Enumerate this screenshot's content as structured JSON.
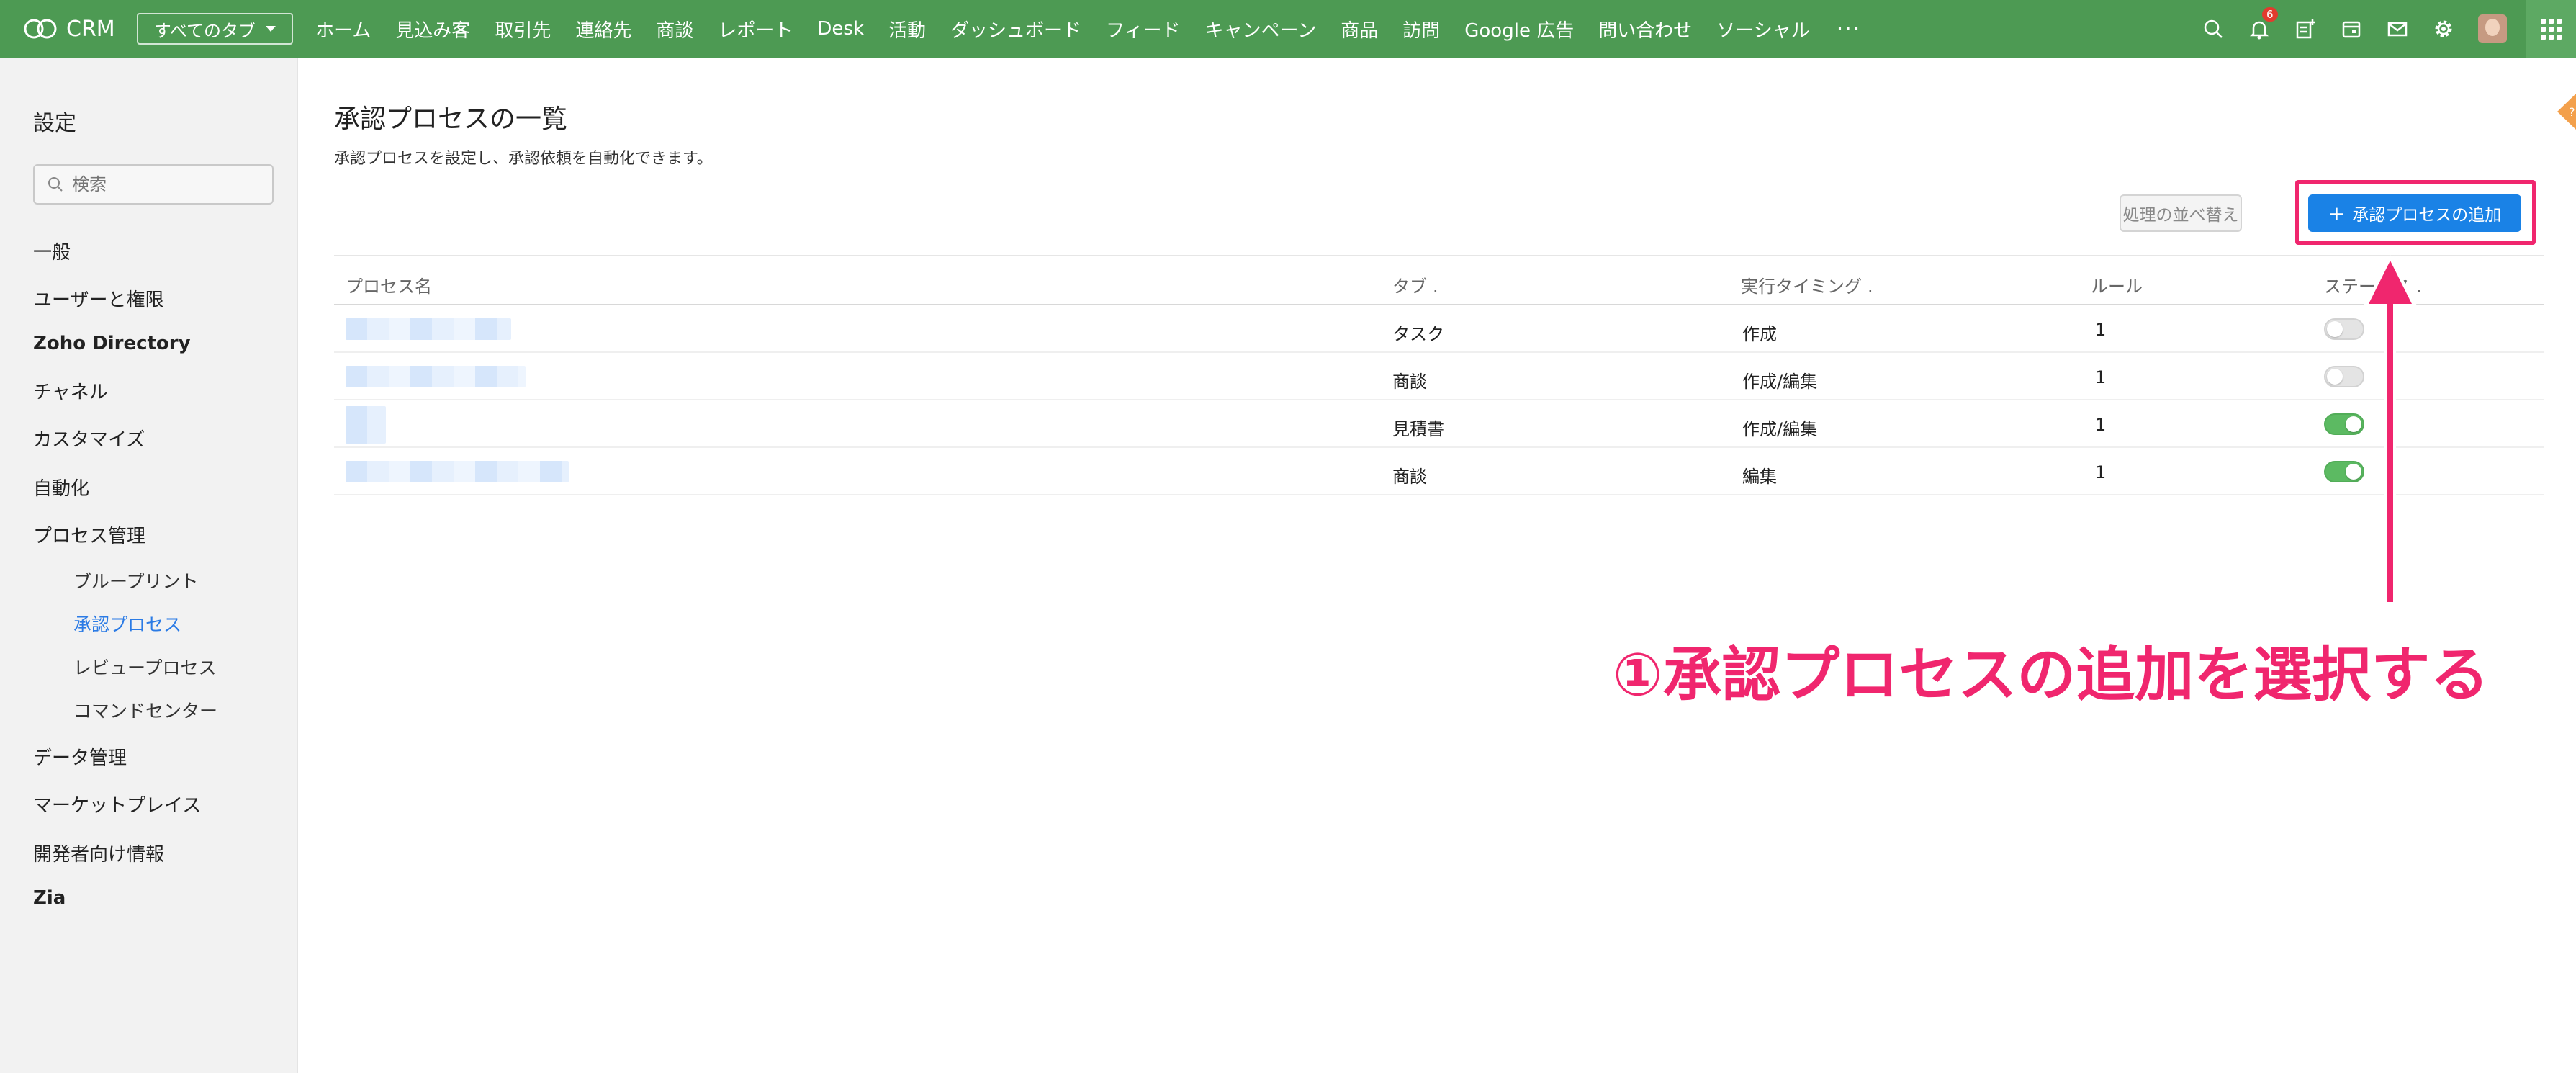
{
  "topbar": {
    "app_name": "CRM",
    "all_tabs_label": "すべてのタブ",
    "nav": [
      "ホーム",
      "見込み客",
      "取引先",
      "連絡先",
      "商談",
      "レポート",
      "Desk",
      "活動",
      "ダッシュボード",
      "フィード",
      "キャンペーン",
      "商品",
      "訪問",
      "Google 広告",
      "問い合わせ",
      "ソーシャル"
    ],
    "more": "···",
    "notification_count": "6",
    "colors": {
      "bar": "#4d9a53"
    }
  },
  "sidebar": {
    "title": "設定",
    "search_placeholder": "検索",
    "items": [
      "一般",
      "ユーザーと権限",
      "Zoho Directory",
      "チャネル",
      "カスタマイズ",
      "自動化",
      "プロセス管理",
      "データ管理",
      "マーケットプレイス",
      "開発者向け情報",
      "Zia"
    ],
    "subitems": [
      "ブループリント",
      "承認プロセス",
      "レビュープロセス",
      "コマンドセンター"
    ],
    "active_subitem": "承認プロセス"
  },
  "main": {
    "title": "承認プロセスの一覧",
    "description": "承認プロセスを設定し、承認依頼を自動化できます。",
    "sort_button": "処理の並べ替え",
    "add_button": "承認プロセスの追加",
    "columns": {
      "name": "プロセス名",
      "tab": "タブ",
      "timing": "実行タイミング",
      "rules": "ルール",
      "status": "ステータス"
    },
    "rows": [
      {
        "tab": "タスク",
        "timing": "作成",
        "rules": "1",
        "enabled": false
      },
      {
        "tab": "商談",
        "timing": "作成/編集",
        "rules": "1",
        "enabled": false
      },
      {
        "tab": "見積書",
        "timing": "作成/編集",
        "rules": "1",
        "enabled": true
      },
      {
        "tab": "商談",
        "timing": "編集",
        "rules": "1",
        "enabled": true
      }
    ]
  },
  "annotation": {
    "text": "①承認プロセスの追加を選択する",
    "color": "#f0266e"
  }
}
